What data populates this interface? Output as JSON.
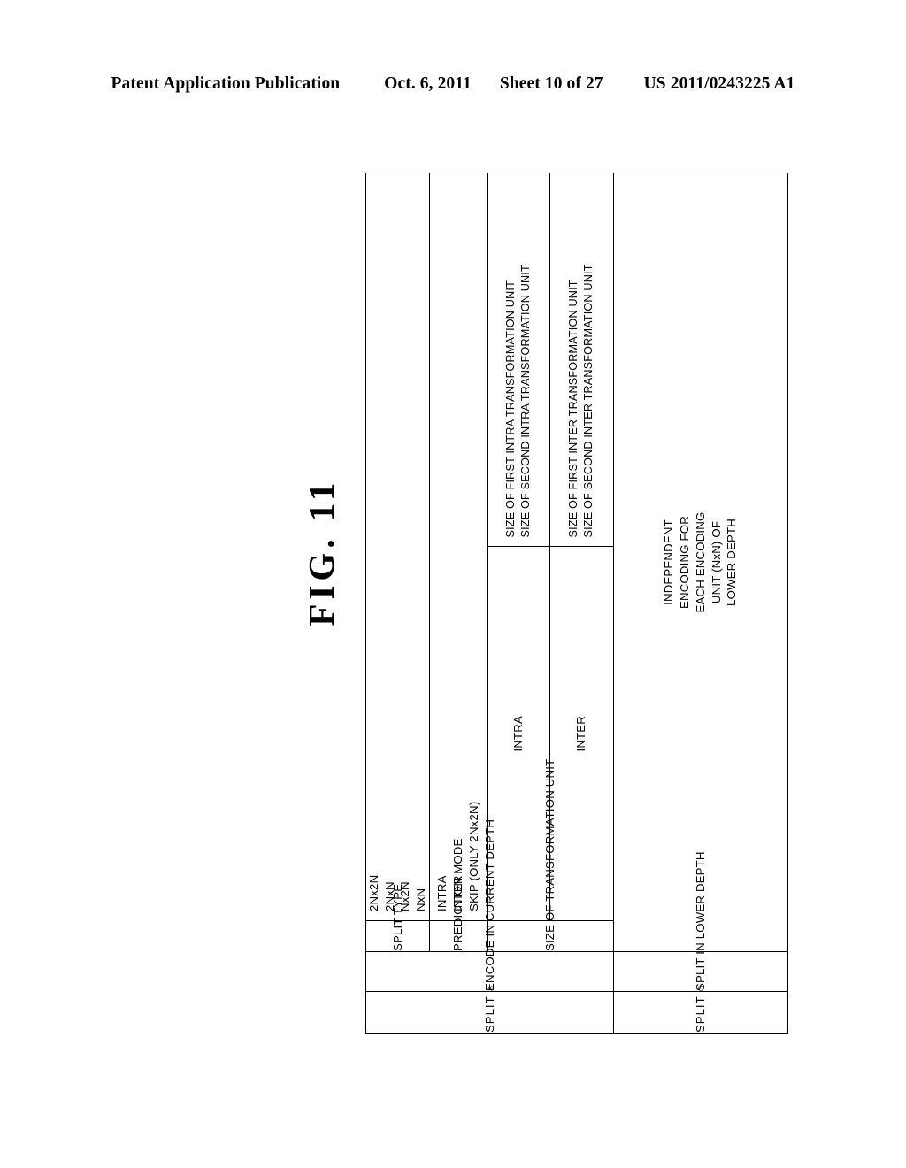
{
  "header": {
    "publication": "Patent Application Publication",
    "date": "Oct. 6, 2011",
    "sheet": "Sheet 10 of 27",
    "patent_number": "US 2011/0243225 A1"
  },
  "figure": {
    "label": "FIG.  11"
  },
  "table": {
    "split_x_label": "SPLIT ×",
    "split_o_label": "SPLIT ○",
    "encode_current_depth": "ENCODE IN CURRENT DEPTH",
    "split_lower_depth": "SPLIT IN LOWER DEPTH",
    "lower_depth_description": [
      "INDEPENDENT",
      "ENCODING FOR",
      "EACH ENCODING",
      "UNIT (NxN) OF",
      "LOWER DEPTH"
    ],
    "columns": {
      "split_type": "SPLIT TYPE",
      "prediction_mode": "PREDICTION MODE",
      "transformation_unit_size": "SIZE OF TRANSFORMATION UNIT"
    },
    "split_type_values": [
      "2Nx2N",
      "2NxN",
      "Nx2N",
      "NxN"
    ],
    "prediction_mode_values": [
      "INTRA",
      "INTER",
      "SKIP (ONLY 2Nx2N)"
    ],
    "transform_groups": [
      {
        "mode": "INTRA",
        "sizes": [
          "SIZE OF FIRST INTRA TRANSFORMATION UNIT",
          "SIZE OF SECOND INTRA TRANSFORMATION UNIT"
        ]
      },
      {
        "mode": "INTER",
        "sizes": [
          "SIZE OF FIRST INTER TRANSFORMATION UNIT",
          "SIZE OF SECOND INTER TRANSFORMATION UNIT"
        ]
      }
    ]
  }
}
